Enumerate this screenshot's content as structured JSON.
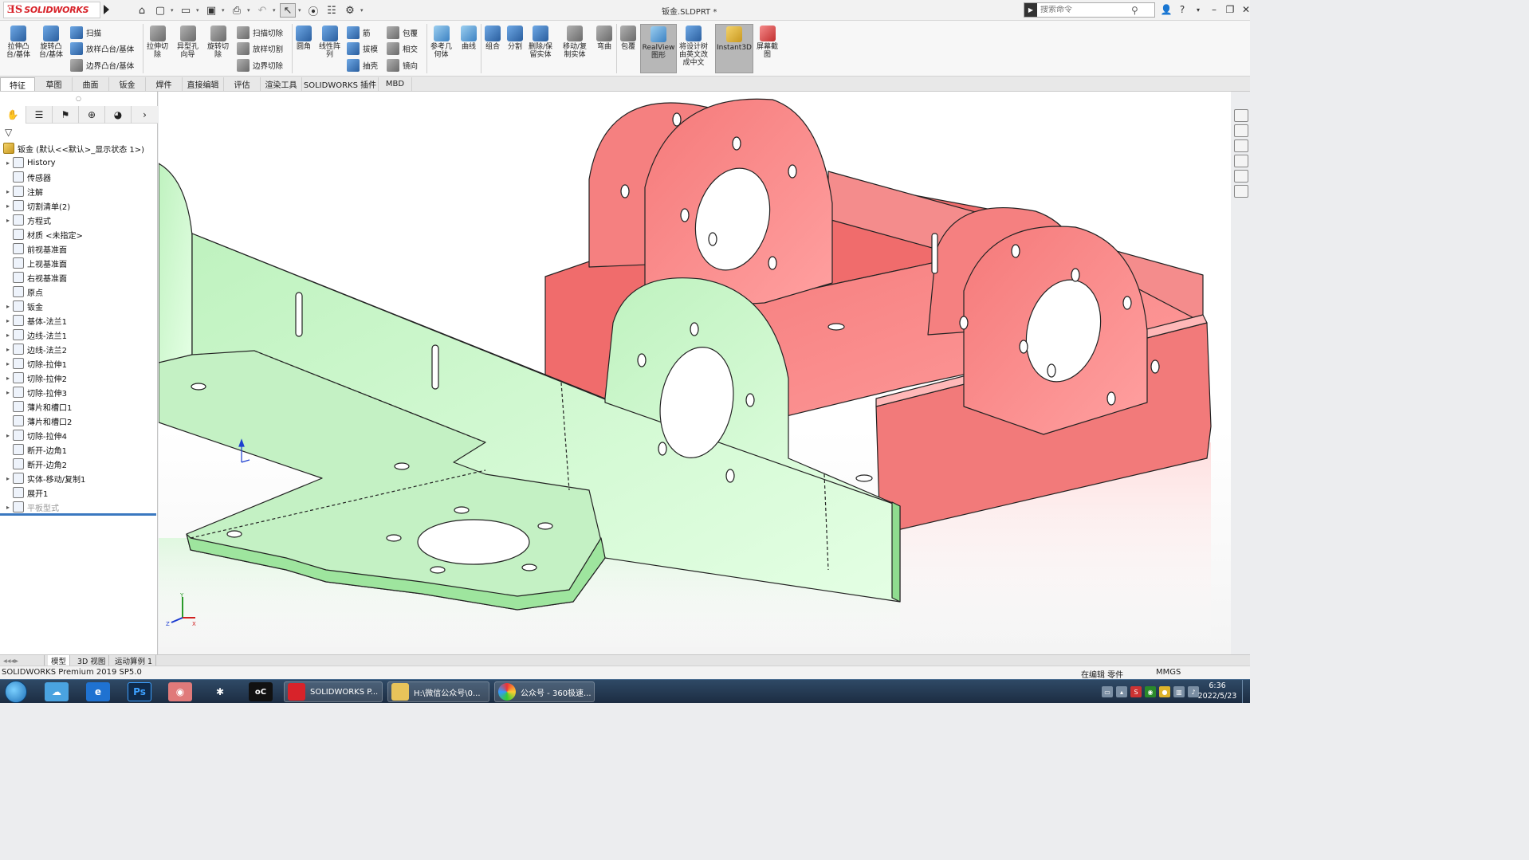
{
  "titlebar": {
    "document_title": "钣金.SLDPRT *",
    "search_placeholder": "搜索命令",
    "help": "?"
  },
  "ribbon": {
    "large": [
      {
        "label1": "拉伸凸",
        "label2": "台/基体",
        "color": "ib"
      },
      {
        "label1": "旋转凸",
        "label2": "台/基体",
        "color": "ib"
      },
      {
        "label1": "拉伸切",
        "label2": "除",
        "color": "ig"
      },
      {
        "label1": "异型孔",
        "label2": "向导",
        "color": "ig"
      },
      {
        "label1": "旋转切",
        "label2": "除",
        "color": "ig"
      },
      {
        "label1": "圆角",
        "label2": "",
        "color": "ib"
      },
      {
        "label1": "线性阵",
        "label2": "列",
        "color": "ib"
      },
      {
        "label1": "参考几",
        "label2": "何体",
        "color": "ic2"
      },
      {
        "label1": "曲线",
        "label2": "",
        "color": "ic2"
      },
      {
        "label1": "组合",
        "label2": "",
        "color": "ib"
      },
      {
        "label1": "分割",
        "label2": "",
        "color": "ib"
      },
      {
        "label1": "删除/保",
        "label2": "留实体",
        "color": "ib"
      },
      {
        "label1": "移动/复",
        "label2": "制实体",
        "color": "ig"
      },
      {
        "label1": "弯曲",
        "label2": "",
        "color": "ig"
      },
      {
        "label1": "包覆",
        "label2": "",
        "color": "ig"
      },
      {
        "label1": "RealView",
        "label2": "图形",
        "color": "ic2"
      },
      {
        "label1": "将设计树",
        "label2": "由英文改",
        "label3": "成中文",
        "color": "ib"
      },
      {
        "label1": "Instant3D",
        "label2": "",
        "color": "iy"
      },
      {
        "label1": "屏幕截",
        "label2": "图",
        "color": "ir"
      }
    ],
    "small": [
      {
        "label": "扫描"
      },
      {
        "label": "放样凸台/基体"
      },
      {
        "label": "边界凸台/基体"
      },
      {
        "label": "扫描切除"
      },
      {
        "label": "放样切割"
      },
      {
        "label": "边界切除"
      },
      {
        "label": "筋"
      },
      {
        "label": "拔模"
      },
      {
        "label": "抽壳"
      },
      {
        "label": "包覆"
      },
      {
        "label": "相交"
      },
      {
        "label": "镜向"
      }
    ]
  },
  "tabs": [
    "特征",
    "草图",
    "曲面",
    "钣金",
    "焊件",
    "直接编辑",
    "评估",
    "渲染工具",
    "SOLIDWORKS 插件",
    "MBD"
  ],
  "tree": {
    "root": "钣金  (默认<<默认>_显示状态 1>)",
    "items": [
      {
        "label": "History",
        "exp": true
      },
      {
        "label": "传感器",
        "exp": false
      },
      {
        "label": "注解",
        "exp": true
      },
      {
        "label": "切割清单(2)",
        "exp": true
      },
      {
        "label": "方程式",
        "exp": true
      },
      {
        "label": "材质 <未指定>",
        "exp": false
      },
      {
        "label": "前视基准面",
        "exp": false
      },
      {
        "label": "上视基准面",
        "exp": false
      },
      {
        "label": "右视基准面",
        "exp": false
      },
      {
        "label": "原点",
        "exp": false
      },
      {
        "label": "钣金",
        "exp": true
      },
      {
        "label": "基体-法兰1",
        "exp": true
      },
      {
        "label": "边线-法兰1",
        "exp": true
      },
      {
        "label": "边线-法兰2",
        "exp": true
      },
      {
        "label": "切除-拉伸1",
        "exp": true
      },
      {
        "label": "切除-拉伸2",
        "exp": true
      },
      {
        "label": "切除-拉伸3",
        "exp": true
      },
      {
        "label": "薄片和槽口1",
        "exp": false
      },
      {
        "label": "薄片和槽口2",
        "exp": false
      },
      {
        "label": "切除-拉伸4",
        "exp": true
      },
      {
        "label": "断开-边角1",
        "exp": false
      },
      {
        "label": "断开-边角2",
        "exp": false
      },
      {
        "label": "实体-移动/复制1",
        "exp": true
      },
      {
        "label": "展开1",
        "exp": false
      },
      {
        "label": "平板型式",
        "exp": true,
        "dim": true
      }
    ]
  },
  "bottom_tabs": [
    "模型",
    "3D 视图",
    "运动算例 1"
  ],
  "status": {
    "product": "SOLIDWORKS Premium 2019 SP5.0",
    "mode": "在编辑 零件",
    "units": "MMGS"
  },
  "taskbar": {
    "items": [
      {
        "label": "SOLIDWORKS P..."
      },
      {
        "label": "H:\\微信公众号\\0..."
      },
      {
        "label": "公众号 - 360极速..."
      }
    ],
    "time": "6:36",
    "date": "2022/5/23"
  },
  "triad": {
    "x": "X",
    "y": "Y",
    "z": "Z"
  }
}
